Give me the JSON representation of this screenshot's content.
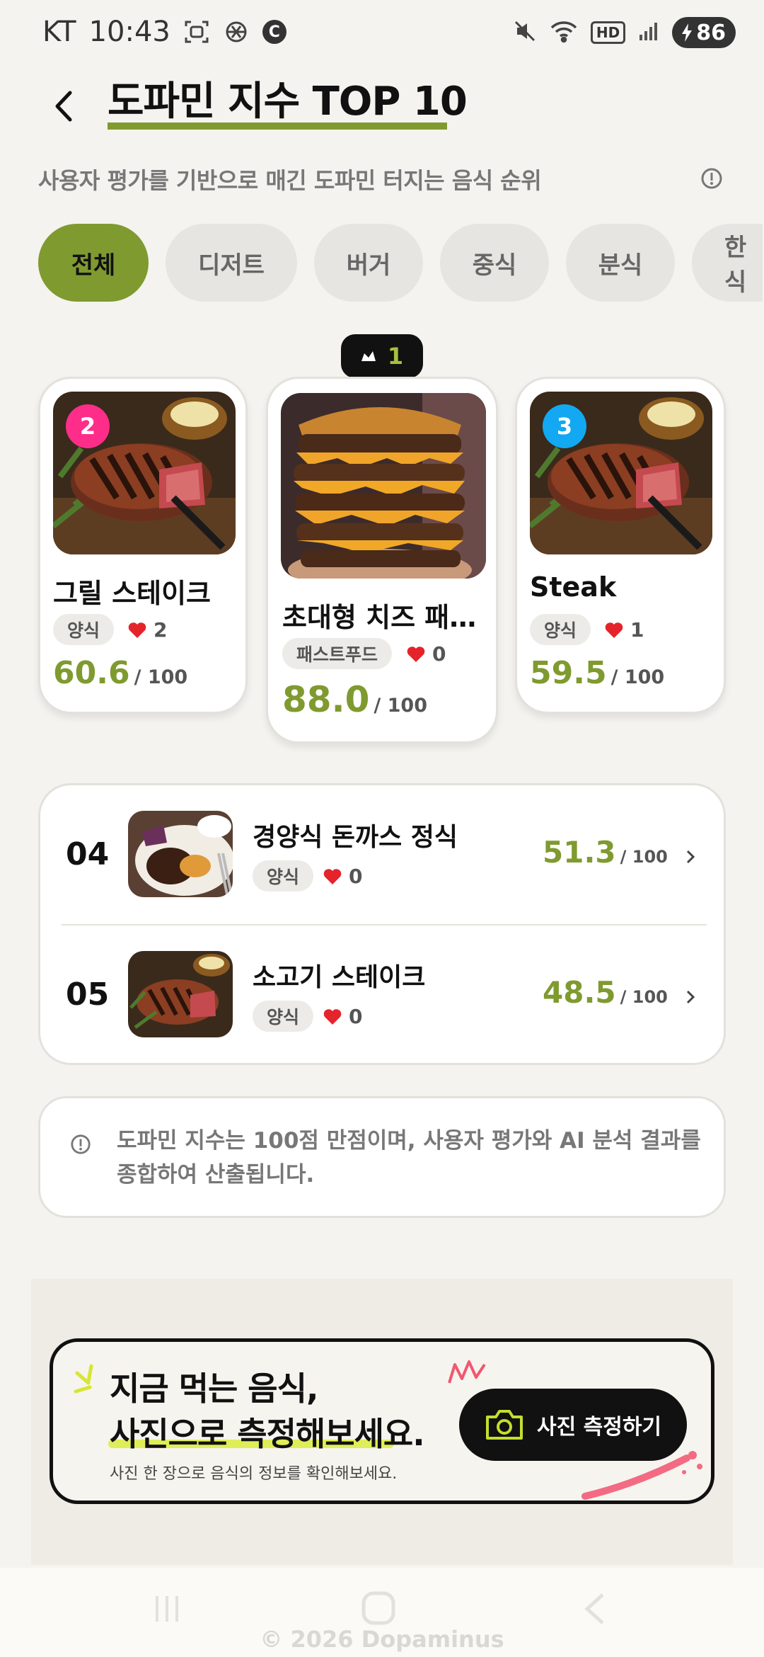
{
  "status_bar": {
    "carrier": "KT",
    "time": "10:43",
    "hd_label": "HD",
    "battery": "86",
    "c_badge": "C"
  },
  "header": {
    "title": "도파민 지수 TOP 10",
    "subtitle": "사용자 평가를 기반으로 매긴 도파민 터지는 음식 순위"
  },
  "filters": [
    "전체",
    "디저트",
    "버거",
    "중식",
    "분식",
    "한식"
  ],
  "top_rank_badge": "1",
  "podium": [
    {
      "rank": "2",
      "name": "그릴 스테이크",
      "category": "양식",
      "likes": "2",
      "score": "60.6",
      "score_max": "/ 100",
      "rank_color": "#ff2d8a"
    },
    {
      "rank": "1",
      "name": "초대형 치즈 패티…",
      "category": "패스트푸드",
      "likes": "0",
      "score": "88.0",
      "score_max": "/ 100"
    },
    {
      "rank": "3",
      "name": "Steak",
      "category": "양식",
      "likes": "1",
      "score": "59.5",
      "score_max": "/ 100",
      "rank_color": "#12a9f2"
    }
  ],
  "list": [
    {
      "rank": "04",
      "name": "경양식 돈까스 정식",
      "category": "양식",
      "likes": "0",
      "score": "51.3",
      "score_max": "/ 100"
    },
    {
      "rank": "05",
      "name": "소고기 스테이크",
      "category": "양식",
      "likes": "0",
      "score": "48.5",
      "score_max": "/ 100"
    }
  ],
  "info_note": "도파민 지수는 100점 만점이며, 사용자 평가와 AI 분석 결과를 종합하여 산출됩니다.",
  "promo": {
    "line1": "지금 먹는 음식,",
    "line2": "사진으로 측정해보세요.",
    "sub": "사진 한 장으로 음식의 정보를 확인해보세요.",
    "button": "사진 측정하기"
  },
  "footer": {
    "copyright": "© 2026 Dopaminus"
  },
  "colors": {
    "accent": "#7f9a2f",
    "rank2": "#ff2d8a",
    "rank3": "#12a9f2",
    "heart": "#e5232b"
  }
}
